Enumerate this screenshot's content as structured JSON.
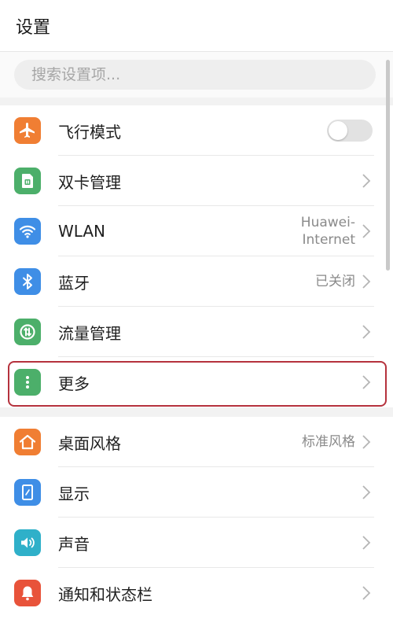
{
  "header": {
    "title": "设置"
  },
  "search": {
    "placeholder": "搜索设置项..."
  },
  "colors": {
    "airplane": "#f07e33",
    "sim": "#4caf6a",
    "wlan": "#3f8ee6",
    "bluetooth": "#3f8ee6",
    "data": "#4caf6a",
    "more": "#4caf6a",
    "theme": "#f07e33",
    "display": "#3f8ee6",
    "sound": "#2fb0c9",
    "notification": "#e8533a",
    "highlight_border": "#b5323d"
  },
  "group1": [
    {
      "label": "飞行模式",
      "icon": "airplane-icon",
      "control": "toggle",
      "toggle_on": false
    },
    {
      "label": "双卡管理",
      "icon": "sim-card-icon",
      "control": "chevron"
    },
    {
      "label": "WLAN",
      "icon": "wifi-icon",
      "value_line1": "Huawei-",
      "value_line2": "Internet",
      "control": "chevron"
    },
    {
      "label": "蓝牙",
      "icon": "bluetooth-icon",
      "value": "已关闭",
      "control": "chevron"
    },
    {
      "label": "流量管理",
      "icon": "data-usage-icon",
      "control": "chevron"
    },
    {
      "label": "更多",
      "icon": "more-dots-icon",
      "control": "chevron",
      "highlighted": true
    }
  ],
  "group2": [
    {
      "label": "桌面风格",
      "icon": "home-icon",
      "value": "标准风格",
      "control": "chevron"
    },
    {
      "label": "显示",
      "icon": "display-icon",
      "control": "chevron"
    },
    {
      "label": "声音",
      "icon": "sound-icon",
      "control": "chevron"
    },
    {
      "label": "通知和状态栏",
      "icon": "bell-icon",
      "control": "chevron"
    }
  ]
}
